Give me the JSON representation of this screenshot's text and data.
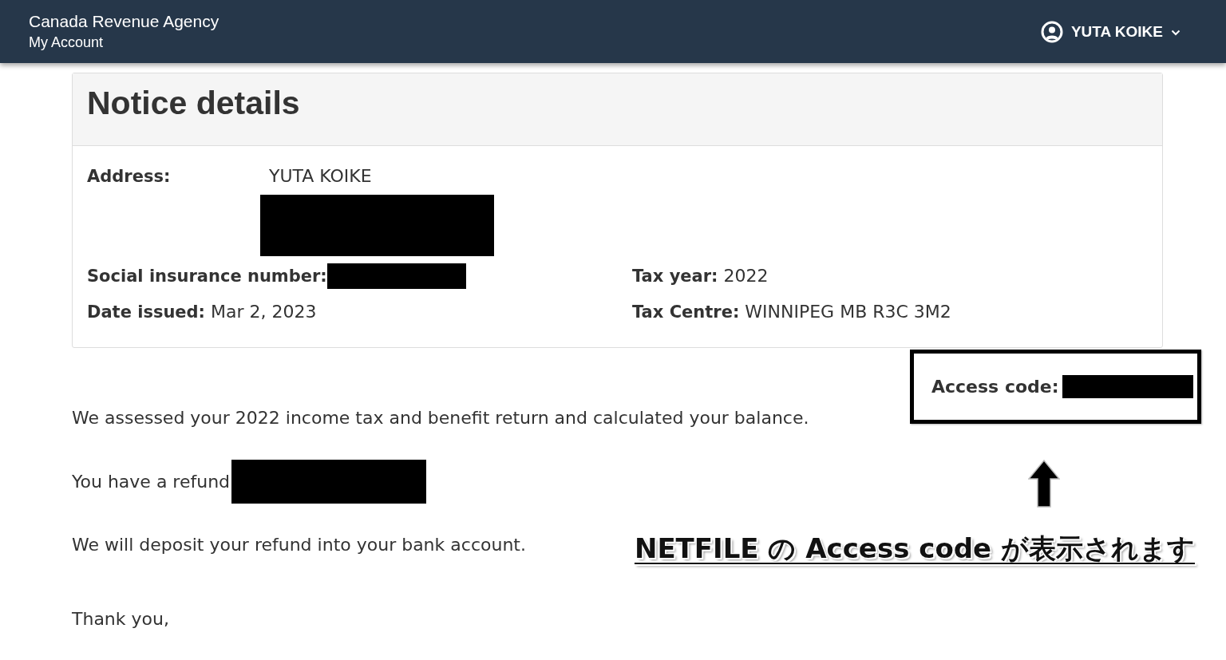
{
  "header": {
    "agency": "Canada Revenue Agency",
    "app": "My Account",
    "user": "YUTA KOIKE"
  },
  "notice": {
    "title": "Notice details",
    "address": {
      "label": "Address:",
      "name": "YUTA KOIKE",
      "redacted": true
    },
    "fields": [
      {
        "label": "Social insurance number:",
        "redacted": true
      },
      {
        "label": "Tax year:",
        "value": "2022",
        "redacted": false
      },
      {
        "label": "Date issued:",
        "value": "Mar 2, 2023",
        "redacted": false
      },
      {
        "label": "Tax Centre:",
        "value": "WINNIPEG MB R3C 3M2",
        "redacted": false
      }
    ]
  },
  "messages": [
    {
      "text": "We assessed your 2022 income tax and benefit return and calculated your balance.",
      "redacted": false
    },
    {
      "text": "You have a refund",
      "redacted": true
    },
    {
      "text": "We will deposit your refund into your bank account.",
      "redacted": false
    }
  ],
  "closing": "Thank you,",
  "annotation": {
    "access_code": {
      "label": "Access code:",
      "redacted": true
    },
    "caption": "NETFILE の Access code が表示されます"
  }
}
